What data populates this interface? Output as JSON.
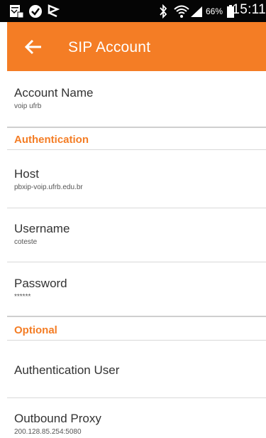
{
  "status_bar": {
    "battery_percent": "66%",
    "time": "15:11",
    "icons": [
      "image-notification-icon",
      "check-circle-icon",
      "flag-icon",
      "bluetooth-icon",
      "wifi-icon",
      "signal-icon",
      "battery-icon"
    ]
  },
  "app_bar": {
    "title": "SIP Account",
    "back_icon": "back-arrow-icon"
  },
  "colors": {
    "accent": "#f47d25",
    "status_bar": "#050505",
    "divider": "#d9d9d9"
  },
  "account_name": {
    "title": "Account Name",
    "value": "voip ufrb"
  },
  "authentication_header": "Authentication",
  "host": {
    "title": "Host",
    "value": "pbxip-voip.ufrb.edu.br"
  },
  "username": {
    "title": "Username",
    "value": "coteste"
  },
  "password": {
    "title": "Password",
    "value": "******"
  },
  "optional_header": "Optional",
  "authentication_user": {
    "title": "Authentication User"
  },
  "outbound_proxy": {
    "title": "Outbound Proxy",
    "value": "200.128.85.254:5080"
  }
}
